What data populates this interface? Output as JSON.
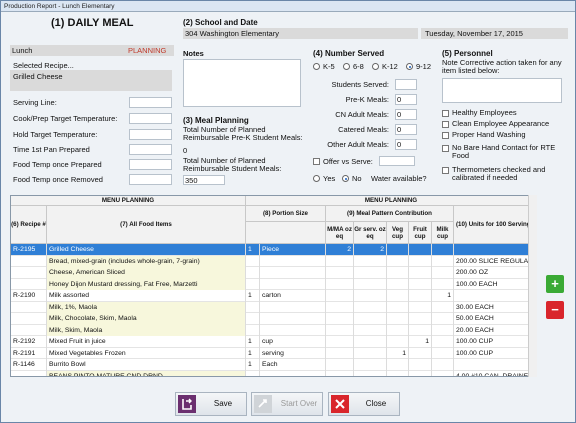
{
  "window": {
    "title": "Production Report - Lunch Elementary"
  },
  "section1": {
    "title": "(1) DAILY MEAL",
    "meal": "Lunch",
    "status": "PLANNING",
    "selected_recipe_label": "Selected Recipe...",
    "selected_recipe_value": "Grilled Cheese",
    "fields": [
      {
        "label": "Serving Line:",
        "value": ""
      },
      {
        "label": "Cook/Prep Target Temperature:",
        "value": ""
      },
      {
        "label": "Hold Target Temperature:",
        "value": ""
      },
      {
        "label": "Time 1st Pan Prepared",
        "value": ""
      },
      {
        "label": "Food Temp once Prepared",
        "value": ""
      },
      {
        "label": "Food Temp once Removed",
        "value": ""
      }
    ]
  },
  "section2": {
    "title": "(2) School and Date",
    "school": "304 Washington Elementary",
    "date": "Tuesday, November 17, 2015"
  },
  "notes": {
    "label": "Notes",
    "value": ""
  },
  "section3": {
    "title": "(3) Meal Planning",
    "prek_label": "Total Number of Planned Reimbursable Pre-K Student Meals:",
    "prek_value": "0",
    "student_label": "Total Number of Planned Reimbursable Student Meals:",
    "student_value": "350"
  },
  "section4": {
    "title": "(4) Number Served",
    "grades": [
      "K-5",
      "6-8",
      "K-12",
      "9-12"
    ],
    "selected_grade": "9-12",
    "fields": [
      {
        "label": "Students Served:",
        "value": ""
      },
      {
        "label": "Pre-K Meals:",
        "value": "0"
      },
      {
        "label": "CN Adult Meals:",
        "value": "0"
      },
      {
        "label": "Catered Meals:",
        "value": "0"
      },
      {
        "label": "Other Adult Meals:",
        "value": "0"
      }
    ],
    "offer_label": "Offer vs Serve:",
    "offer_value": "",
    "yes_label": "Yes",
    "no_label": "No",
    "water_label": "Water available?",
    "water_selected": "No"
  },
  "section5": {
    "title": "(5) Personnel",
    "note": "Note Corrective action taken for any item listed below:",
    "note_value": "",
    "checks": [
      "Healthy Employees",
      "Clean Employee Appearance",
      "Proper Hand Washing",
      "No Bare Hand Contact for RTE Food",
      "Thermometers checked and calibrated if needed"
    ]
  },
  "grid": {
    "group_left": "MENU PLANNING",
    "group_right": "MENU PLANNING",
    "headers": {
      "recipe": "(6) Recipe #",
      "food": "(7) All Food Items",
      "portion": "(8) Portion Size",
      "pattern": "(9) Meal Pattern Contribution",
      "mm": "M/MA oz eq",
      "gr": "Gr serv. oz eq",
      "veg": "Veg cup",
      "fruit": "Fruit cup",
      "milk": "Milk cup",
      "units": "(10) Units for 100 Servings"
    },
    "rows": [
      {
        "recipe": "R-2195",
        "food": "Grilled Cheese",
        "qty": "1",
        "unit": "Piece",
        "mm": "2",
        "gr": "2",
        "veg": "",
        "fruit": "",
        "milk": "",
        "units": "",
        "selected": true,
        "yellow": false
      },
      {
        "recipe": "",
        "food": "Bread, mixed-grain (includes whole-grain, 7-grain)",
        "qty": "",
        "unit": "",
        "mm": "",
        "gr": "",
        "veg": "",
        "fruit": "",
        "milk": "",
        "units": "200.00 SLICE REGULAR",
        "selected": false,
        "yellow": true
      },
      {
        "recipe": "",
        "food": "Cheese, American Sliced",
        "qty": "",
        "unit": "",
        "mm": "",
        "gr": "",
        "veg": "",
        "fruit": "",
        "milk": "",
        "units": "200.00 OZ",
        "selected": false,
        "yellow": true
      },
      {
        "recipe": "",
        "food": "Honey Dijon Mustard dressing, Fat Free, Marzetti",
        "qty": "",
        "unit": "",
        "mm": "",
        "gr": "",
        "veg": "",
        "fruit": "",
        "milk": "",
        "units": "100.00 EACH",
        "selected": false,
        "yellow": true
      },
      {
        "recipe": "R-2190",
        "food": "Milk assorted",
        "qty": "1",
        "unit": "carton",
        "mm": "",
        "gr": "",
        "veg": "",
        "fruit": "",
        "milk": "1",
        "units": "",
        "selected": false,
        "yellow": false
      },
      {
        "recipe": "",
        "food": "Milk, 1%, Maola",
        "qty": "",
        "unit": "",
        "mm": "",
        "gr": "",
        "veg": "",
        "fruit": "",
        "milk": "",
        "units": "30.00 EACH",
        "selected": false,
        "yellow": true
      },
      {
        "recipe": "",
        "food": "Milk, Chocolate, Skim, Maola",
        "qty": "",
        "unit": "",
        "mm": "",
        "gr": "",
        "veg": "",
        "fruit": "",
        "milk": "",
        "units": "50.00 EACH",
        "selected": false,
        "yellow": true
      },
      {
        "recipe": "",
        "food": "Milk, Skim, Maola",
        "qty": "",
        "unit": "",
        "mm": "",
        "gr": "",
        "veg": "",
        "fruit": "",
        "milk": "",
        "units": "20.00 EACH",
        "selected": false,
        "yellow": true
      },
      {
        "recipe": "R-2192",
        "food": "Mixed Fruit in juice",
        "qty": "1",
        "unit": "cup",
        "mm": "",
        "gr": "",
        "veg": "",
        "fruit": "1",
        "milk": "",
        "units": "100.00 CUP",
        "selected": false,
        "yellow": false
      },
      {
        "recipe": "R-2191",
        "food": "Mixed Vegetables Frozen",
        "qty": "1",
        "unit": "serving",
        "mm": "",
        "gr": "",
        "veg": "1",
        "fruit": "",
        "milk": "",
        "units": "100.00 CUP",
        "selected": false,
        "yellow": false
      },
      {
        "recipe": "R-1146",
        "food": "Burrito Bowl",
        "qty": "1",
        "unit": "Each",
        "mm": "",
        "gr": "",
        "veg": "",
        "fruit": "",
        "milk": "",
        "units": "",
        "selected": false,
        "yellow": false
      },
      {
        "recipe": "",
        "food": "BEANS,PINTO,MATURE,CND,DRND",
        "qty": "",
        "unit": "",
        "mm": "",
        "gr": "",
        "veg": "",
        "fruit": "",
        "milk": "",
        "units": "4.00 #10 CAN, DRAINED",
        "selected": false,
        "yellow": true
      }
    ]
  },
  "buttons": {
    "save": "Save",
    "start_over": "Start Over",
    "close": "Close"
  },
  "colors": {
    "selected_row": "#2f7fd6",
    "add": "#3aaa35",
    "remove": "#d9262c",
    "planning": "#c0392b"
  }
}
